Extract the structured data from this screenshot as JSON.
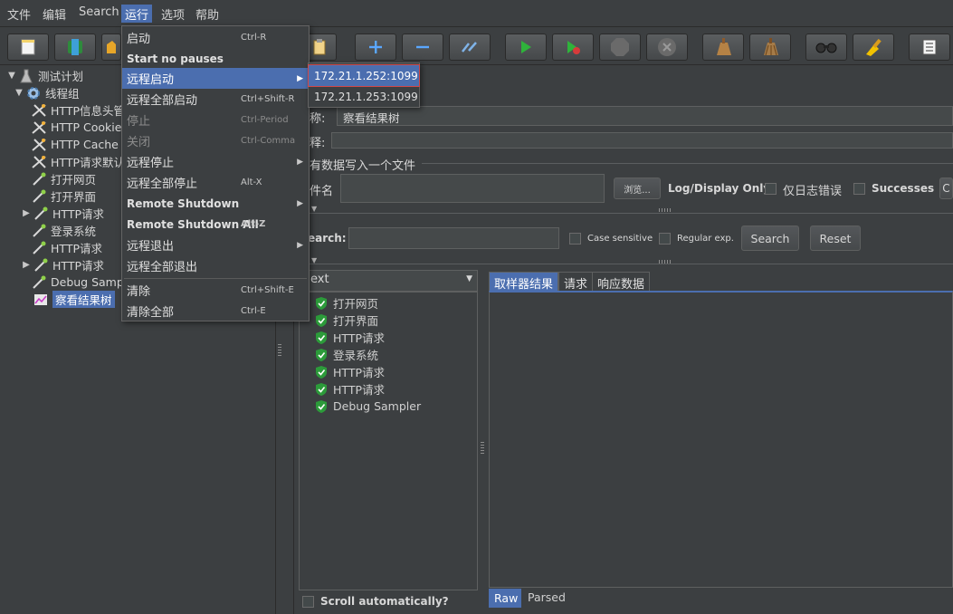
{
  "menubar": {
    "items": [
      {
        "label": "文件"
      },
      {
        "label": "编辑"
      },
      {
        "label": "Search"
      },
      {
        "label": "运行"
      },
      {
        "label": "选项"
      },
      {
        "label": "帮助"
      }
    ]
  },
  "toolbar": {
    "buttons": [
      "new-icon",
      "templates-icon",
      "open-icon",
      "save-icon",
      "add-icon",
      "remove-icon",
      "toggle-icon",
      "start-icon",
      "start-no-pause-icon",
      "stop-icon",
      "shutdown-icon",
      "clear-icon",
      "clear-all-icon",
      "search-icon",
      "reset-search-icon",
      "function-helper-icon"
    ]
  },
  "tree": {
    "items": [
      {
        "label": "测试计划",
        "icon": "test-plan-icon"
      },
      {
        "label": "线程组",
        "icon": "thread-group-icon"
      },
      {
        "label": "HTTP信息头管",
        "icon": "config-icon"
      },
      {
        "label": "HTTP Cookie",
        "icon": "config-icon"
      },
      {
        "label": "HTTP Cache",
        "icon": "config-icon"
      },
      {
        "label": "HTTP请求默认",
        "icon": "config-icon"
      },
      {
        "label": "打开网页",
        "icon": "sampler-icon"
      },
      {
        "label": "打开界面",
        "icon": "sampler-icon"
      },
      {
        "label": "HTTP请求",
        "icon": "sampler-icon"
      },
      {
        "label": "登录系统",
        "icon": "sampler-icon"
      },
      {
        "label": "HTTP请求",
        "icon": "sampler-icon"
      },
      {
        "label": "HTTP请求",
        "icon": "sampler-icon"
      },
      {
        "label": "Debug Samp",
        "icon": "sampler-icon"
      },
      {
        "label": "察看结果树",
        "icon": "listener-icon"
      }
    ]
  },
  "run_menu": {
    "items": [
      {
        "label": "启动",
        "accel": "Ctrl-R"
      },
      {
        "label": "Start no pauses",
        "accel": ""
      },
      {
        "label": "远程启动",
        "accel": ""
      },
      {
        "label": "远程全部启动",
        "accel": "Ctrl+Shift-R"
      },
      {
        "label": "停止",
        "accel": "Ctrl-Period"
      },
      {
        "label": "关闭",
        "accel": "Ctrl-Comma"
      },
      {
        "label": "远程停止",
        "accel": ""
      },
      {
        "label": "远程全部停止",
        "accel": "Alt-X"
      },
      {
        "label": "Remote Shutdown",
        "accel": ""
      },
      {
        "label": "Remote Shutdown All",
        "accel": "Alt-Z"
      },
      {
        "label": "远程退出",
        "accel": ""
      },
      {
        "label": "远程全部退出",
        "accel": ""
      },
      {
        "label": "清除",
        "accel": "Ctrl+Shift-E"
      },
      {
        "label": "清除全部",
        "accel": "Ctrl-E"
      }
    ]
  },
  "remote_submenu": {
    "items": [
      "172.21.1.252:1099",
      "172.21.1.253:1099"
    ]
  },
  "panel": {
    "name_label": "称:",
    "name_value": "察看结果树",
    "comment_label": "释:",
    "file_group_title": "有数据写入一个文件",
    "filename_label": "件名",
    "browse_label": "浏览...",
    "log_only_label": "Log/Display Only:",
    "errors_only_label": "仅日志错误",
    "successes_label": "Successes",
    "search_label": "earch:",
    "case_sensitive_label": "Case sensitive",
    "regex_label": "Regular exp.",
    "search_button": "Search",
    "reset_button": "Reset",
    "renderer_value": "ext",
    "tabs": [
      "取样器结果",
      "请求",
      "响应数据"
    ],
    "results": [
      "打开网页",
      "打开界面",
      "HTTP请求",
      "登录系统",
      "HTTP请求",
      "HTTP请求",
      "Debug Sampler"
    ],
    "scroll_auto_label": "Scroll automatically?",
    "bottom_tabs": [
      "Raw",
      "Parsed"
    ]
  }
}
